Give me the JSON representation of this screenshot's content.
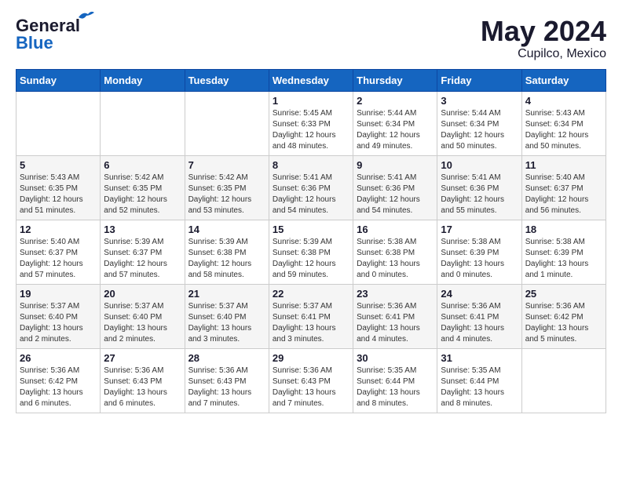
{
  "header": {
    "logo_line1": "General",
    "logo_line2": "Blue",
    "month_year": "May 2024",
    "location": "Cupilco, Mexico"
  },
  "calendar": {
    "days_of_week": [
      "Sunday",
      "Monday",
      "Tuesday",
      "Wednesday",
      "Thursday",
      "Friday",
      "Saturday"
    ],
    "weeks": [
      [
        {
          "day": "",
          "info": ""
        },
        {
          "day": "",
          "info": ""
        },
        {
          "day": "",
          "info": ""
        },
        {
          "day": "1",
          "info": "Sunrise: 5:45 AM\nSunset: 6:33 PM\nDaylight: 12 hours\nand 48 minutes."
        },
        {
          "day": "2",
          "info": "Sunrise: 5:44 AM\nSunset: 6:34 PM\nDaylight: 12 hours\nand 49 minutes."
        },
        {
          "day": "3",
          "info": "Sunrise: 5:44 AM\nSunset: 6:34 PM\nDaylight: 12 hours\nand 50 minutes."
        },
        {
          "day": "4",
          "info": "Sunrise: 5:43 AM\nSunset: 6:34 PM\nDaylight: 12 hours\nand 50 minutes."
        }
      ],
      [
        {
          "day": "5",
          "info": "Sunrise: 5:43 AM\nSunset: 6:35 PM\nDaylight: 12 hours\nand 51 minutes."
        },
        {
          "day": "6",
          "info": "Sunrise: 5:42 AM\nSunset: 6:35 PM\nDaylight: 12 hours\nand 52 minutes."
        },
        {
          "day": "7",
          "info": "Sunrise: 5:42 AM\nSunset: 6:35 PM\nDaylight: 12 hours\nand 53 minutes."
        },
        {
          "day": "8",
          "info": "Sunrise: 5:41 AM\nSunset: 6:36 PM\nDaylight: 12 hours\nand 54 minutes."
        },
        {
          "day": "9",
          "info": "Sunrise: 5:41 AM\nSunset: 6:36 PM\nDaylight: 12 hours\nand 54 minutes."
        },
        {
          "day": "10",
          "info": "Sunrise: 5:41 AM\nSunset: 6:36 PM\nDaylight: 12 hours\nand 55 minutes."
        },
        {
          "day": "11",
          "info": "Sunrise: 5:40 AM\nSunset: 6:37 PM\nDaylight: 12 hours\nand 56 minutes."
        }
      ],
      [
        {
          "day": "12",
          "info": "Sunrise: 5:40 AM\nSunset: 6:37 PM\nDaylight: 12 hours\nand 57 minutes."
        },
        {
          "day": "13",
          "info": "Sunrise: 5:39 AM\nSunset: 6:37 PM\nDaylight: 12 hours\nand 57 minutes."
        },
        {
          "day": "14",
          "info": "Sunrise: 5:39 AM\nSunset: 6:38 PM\nDaylight: 12 hours\nand 58 minutes."
        },
        {
          "day": "15",
          "info": "Sunrise: 5:39 AM\nSunset: 6:38 PM\nDaylight: 12 hours\nand 59 minutes."
        },
        {
          "day": "16",
          "info": "Sunrise: 5:38 AM\nSunset: 6:38 PM\nDaylight: 13 hours\nand 0 minutes."
        },
        {
          "day": "17",
          "info": "Sunrise: 5:38 AM\nSunset: 6:39 PM\nDaylight: 13 hours\nand 0 minutes."
        },
        {
          "day": "18",
          "info": "Sunrise: 5:38 AM\nSunset: 6:39 PM\nDaylight: 13 hours\nand 1 minute."
        }
      ],
      [
        {
          "day": "19",
          "info": "Sunrise: 5:37 AM\nSunset: 6:40 PM\nDaylight: 13 hours\nand 2 minutes."
        },
        {
          "day": "20",
          "info": "Sunrise: 5:37 AM\nSunset: 6:40 PM\nDaylight: 13 hours\nand 2 minutes."
        },
        {
          "day": "21",
          "info": "Sunrise: 5:37 AM\nSunset: 6:40 PM\nDaylight: 13 hours\nand 3 minutes."
        },
        {
          "day": "22",
          "info": "Sunrise: 5:37 AM\nSunset: 6:41 PM\nDaylight: 13 hours\nand 3 minutes."
        },
        {
          "day": "23",
          "info": "Sunrise: 5:36 AM\nSunset: 6:41 PM\nDaylight: 13 hours\nand 4 minutes."
        },
        {
          "day": "24",
          "info": "Sunrise: 5:36 AM\nSunset: 6:41 PM\nDaylight: 13 hours\nand 4 minutes."
        },
        {
          "day": "25",
          "info": "Sunrise: 5:36 AM\nSunset: 6:42 PM\nDaylight: 13 hours\nand 5 minutes."
        }
      ],
      [
        {
          "day": "26",
          "info": "Sunrise: 5:36 AM\nSunset: 6:42 PM\nDaylight: 13 hours\nand 6 minutes."
        },
        {
          "day": "27",
          "info": "Sunrise: 5:36 AM\nSunset: 6:43 PM\nDaylight: 13 hours\nand 6 minutes."
        },
        {
          "day": "28",
          "info": "Sunrise: 5:36 AM\nSunset: 6:43 PM\nDaylight: 13 hours\nand 7 minutes."
        },
        {
          "day": "29",
          "info": "Sunrise: 5:36 AM\nSunset: 6:43 PM\nDaylight: 13 hours\nand 7 minutes."
        },
        {
          "day": "30",
          "info": "Sunrise: 5:35 AM\nSunset: 6:44 PM\nDaylight: 13 hours\nand 8 minutes."
        },
        {
          "day": "31",
          "info": "Sunrise: 5:35 AM\nSunset: 6:44 PM\nDaylight: 13 hours\nand 8 minutes."
        },
        {
          "day": "",
          "info": ""
        }
      ]
    ]
  }
}
